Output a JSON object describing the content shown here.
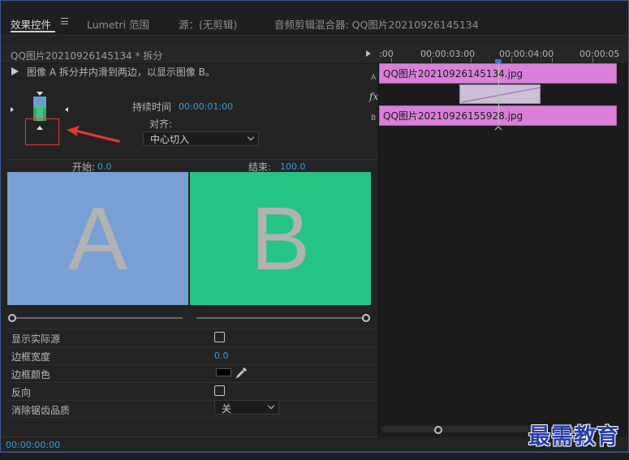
{
  "tabs": [
    {
      "label": "效果控件",
      "active": true
    },
    {
      "label": "Lumetri 范围",
      "active": false
    },
    {
      "label": "源：(无剪辑)",
      "active": false
    },
    {
      "label": "音频剪辑混合器: QQ图片20210926145134",
      "active": false
    }
  ],
  "effect_controls": {
    "clip_name": "QQ图片20210926145134 * 拆分",
    "description": "图像 A 拆分并内滑到两边，以显示图像 B。",
    "duration_label": "持续时间",
    "duration_value": "00:00:01:00",
    "align_label": "对齐:",
    "align_value": "中心切入",
    "start_label": "开始:",
    "start_value": "0.0",
    "end_label": "结束:",
    "end_value": "100.0",
    "preview_a_letter": "A",
    "preview_b_letter": "B",
    "preview_a_color": "#7aa0d3",
    "preview_b_color": "#26c386",
    "properties": {
      "show_actual_source": {
        "label": "显示实际源",
        "checked": false
      },
      "border_width": {
        "label": "边框宽度",
        "value": "0.0"
      },
      "border_color": {
        "label": "边框颜色",
        "value": "#000000"
      },
      "reverse": {
        "label": "反向",
        "checked": false
      },
      "antialiasing": {
        "label": "消除锯齿品质",
        "value": "关"
      }
    },
    "timecode": "00:00:00:00"
  },
  "timeline": {
    "ruler_labels": [
      ":00",
      "00:00:03:00",
      "00:00:04:00",
      "00:00:05"
    ],
    "track_a_label": "A",
    "track_b_label": "B",
    "fx_label": "fx",
    "clip_a_name": "QQ图片20210926145134.jpg",
    "clip_b_name": "QQ图片20210926155928.jpg",
    "clip_color": "#d980d9"
  },
  "annotation": {
    "highlight_color": "#e23838"
  },
  "watermark": "最需教育"
}
